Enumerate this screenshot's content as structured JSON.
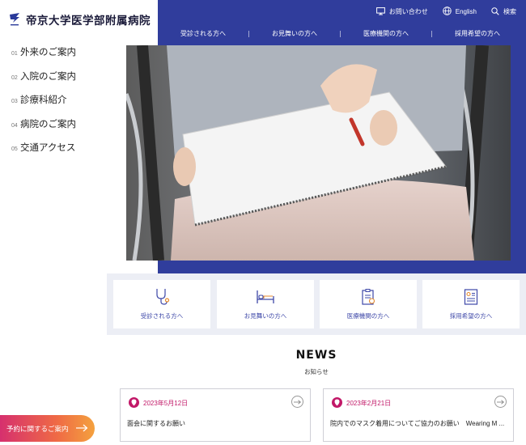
{
  "site": {
    "name": "帝京大学医学部附属病院"
  },
  "sidebar": {
    "items": [
      {
        "num": "01",
        "label": "外来のご案内"
      },
      {
        "num": "02",
        "label": "入院のご案内"
      },
      {
        "num": "03",
        "label": "診療科紹介"
      },
      {
        "num": "04",
        "label": "病院のご案内"
      },
      {
        "num": "05",
        "label": "交通アクセス"
      }
    ],
    "reserve_label": "予約に関するご案内"
  },
  "utility": {
    "contact": "お問い合わせ",
    "language": "English",
    "search": "検索"
  },
  "global_nav": [
    "受診される方へ",
    "お見舞いの方へ",
    "医療機関の方へ",
    "採用希望の方へ"
  ],
  "cards": [
    {
      "label": "受診される方へ",
      "icon": "stethoscope-icon"
    },
    {
      "label": "お見舞いの方へ",
      "icon": "hospital-bed-icon"
    },
    {
      "label": "医療機関の方へ",
      "icon": "clipboard-icon"
    },
    {
      "label": "採用希望の方へ",
      "icon": "resume-icon"
    }
  ],
  "news": {
    "title": "NEWS",
    "subtitle": "お知らせ",
    "items": [
      {
        "date": "2023年5月12日",
        "text": "面会に関するお願い"
      },
      {
        "date": "2023年2月21日",
        "text": "院内でのマスク着用についてご協力のお願い　Wearing M ..."
      }
    ]
  },
  "colors": {
    "primary": "#303d9c",
    "accent": "#c21868",
    "card_label": "#3e48a8"
  }
}
